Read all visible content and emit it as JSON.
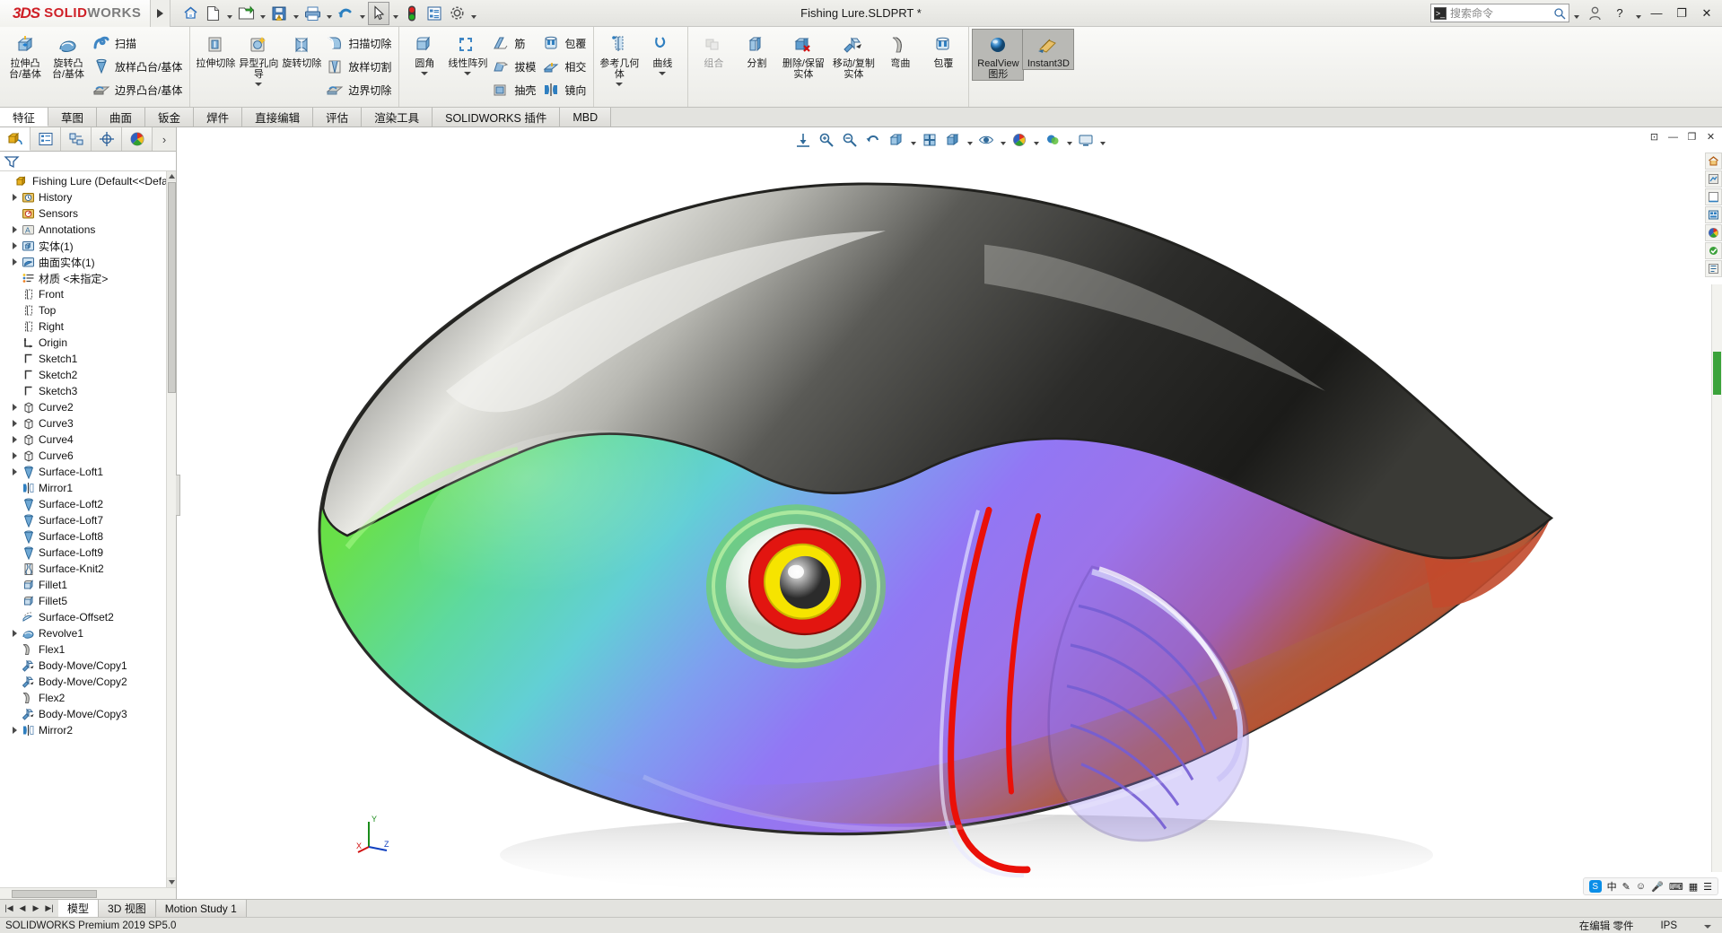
{
  "app": {
    "brand_ds": "3DS",
    "brand_solid": "SOLID",
    "brand_works": "WORKS",
    "document_title": "Fishing Lure.SLDPRT *"
  },
  "quick_access": [
    {
      "name": "home-icon",
      "label": "主页"
    },
    {
      "name": "new-document-icon",
      "label": "新建"
    },
    {
      "name": "open-document-icon",
      "label": "打开"
    },
    {
      "name": "save-icon",
      "label": "保存"
    },
    {
      "name": "print-icon",
      "label": "打印"
    },
    {
      "name": "undo-icon",
      "label": "撤消"
    },
    {
      "name": "select-cursor-icon",
      "label": "选择"
    },
    {
      "name": "rebuild-icon",
      "label": "重建模型"
    },
    {
      "name": "file-properties-icon",
      "label": "文件属性"
    },
    {
      "name": "options-gear-icon",
      "label": "选项"
    }
  ],
  "search": {
    "placeholder": "搜索命令",
    "icon": "magnifier-icon"
  },
  "window_controls": {
    "account": "user-account-icon",
    "help": "?",
    "minimize": "—",
    "restore": "❐",
    "close": "✕"
  },
  "ribbon": {
    "groups": [
      {
        "name": "boss-base-group",
        "big": [
          {
            "label": "拉伸凸台/基体",
            "icon": "extrude-boss-icon",
            "dropdown": false
          },
          {
            "label": "旋转凸台/基体",
            "icon": "revolve-boss-icon",
            "dropdown": false
          }
        ],
        "small": [
          {
            "label": "扫描",
            "icon": "sweep-icon"
          },
          {
            "label": "放样凸台/基体",
            "icon": "loft-boss-icon"
          },
          {
            "label": "边界凸台/基体",
            "icon": "boundary-boss-icon"
          }
        ]
      },
      {
        "name": "cut-group",
        "big": [
          {
            "label": "拉伸切除",
            "icon": "extrude-cut-icon",
            "dropdown": true
          },
          {
            "label": "异型孔向导",
            "icon": "hole-wizard-icon",
            "dropdown": true
          },
          {
            "label": "旋转切除",
            "icon": "revolve-cut-icon",
            "dropdown": false
          }
        ],
        "small": [
          {
            "label": "扫描切除",
            "icon": "sweep-cut-icon"
          },
          {
            "label": "放样切割",
            "icon": "loft-cut-icon"
          },
          {
            "label": "边界切除",
            "icon": "boundary-cut-icon"
          }
        ]
      },
      {
        "name": "feature-group",
        "big": [
          {
            "label": "圆角",
            "icon": "fillet-icon",
            "dropdown": true
          },
          {
            "label": "线性阵列",
            "icon": "linear-pattern-icon",
            "dropdown": true
          }
        ],
        "small": [
          {
            "label": "筋",
            "icon": "rib-icon"
          },
          {
            "label": "拔模",
            "icon": "draft-icon"
          },
          {
            "label": "抽壳",
            "icon": "shell-icon"
          }
        ],
        "small2": [
          {
            "label": "包覆",
            "icon": "wrap-icon"
          },
          {
            "label": "相交",
            "icon": "intersect-icon"
          },
          {
            "label": "镜向",
            "icon": "mirror-icon"
          }
        ]
      },
      {
        "name": "reference-group",
        "big": [
          {
            "label": "参考几何体",
            "icon": "reference-geometry-icon",
            "dropdown": true
          },
          {
            "label": "曲线",
            "icon": "curves-icon",
            "dropdown": true
          }
        ]
      },
      {
        "name": "bodies-group",
        "big": [
          {
            "label": "组合",
            "icon": "combine-icon",
            "disabled": true
          },
          {
            "label": "分割",
            "icon": "split-icon",
            "disabled": false
          },
          {
            "label": "删除/保留实体",
            "icon": "delete-keep-body-icon",
            "disabled": false
          },
          {
            "label": "移动/复制实体",
            "icon": "move-copy-body-icon",
            "disabled": false
          },
          {
            "label": "弯曲",
            "icon": "flex-icon",
            "disabled": false
          },
          {
            "label": "包覆",
            "icon": "wrap-icon",
            "disabled": false
          }
        ]
      },
      {
        "name": "display-group",
        "big": [
          {
            "label": "RealView 图形",
            "icon": "realview-sphere-icon",
            "active": true
          },
          {
            "label": "Instant3D",
            "icon": "instant3d-icon",
            "active": true
          }
        ]
      }
    ]
  },
  "command_tabs": {
    "items": [
      "特征",
      "草图",
      "曲面",
      "钣金",
      "焊件",
      "直接编辑",
      "评估",
      "渲染工具",
      "SOLIDWORKS 插件",
      "MBD"
    ],
    "selected_index": 0
  },
  "left_panel": {
    "tabs": [
      {
        "name": "feature-manager-tab",
        "icon": "feature-tree-icon",
        "selected": true
      },
      {
        "name": "property-manager-tab",
        "icon": "property-list-icon",
        "selected": false
      },
      {
        "name": "configuration-manager-tab",
        "icon": "configuration-icon",
        "selected": false
      },
      {
        "name": "dimxpert-manager-tab",
        "icon": "dimxpert-icon",
        "selected": false
      },
      {
        "name": "display-manager-tab",
        "icon": "display-palette-icon",
        "selected": false
      }
    ],
    "more_chevron": "›",
    "filter_icon": "filter-funnel-icon",
    "tree": [
      {
        "label": "Fishing Lure  (Default<<Default>_",
        "icon": "part-icon",
        "arrow": false,
        "root": true
      },
      {
        "label": "History",
        "icon": "history-icon",
        "arrow": true
      },
      {
        "label": "Sensors",
        "icon": "sensors-icon",
        "arrow": false
      },
      {
        "label": "Annotations",
        "icon": "annotations-icon",
        "arrow": true
      },
      {
        "label": "实体(1)",
        "icon": "solid-bodies-icon",
        "arrow": true
      },
      {
        "label": "曲面实体(1)",
        "icon": "surface-bodies-icon",
        "arrow": true
      },
      {
        "label": "材质 <未指定>",
        "icon": "material-icon",
        "arrow": false
      },
      {
        "label": "Front",
        "icon": "plane-icon",
        "arrow": false
      },
      {
        "label": "Top",
        "icon": "plane-icon",
        "arrow": false
      },
      {
        "label": "Right",
        "icon": "plane-icon",
        "arrow": false
      },
      {
        "label": "Origin",
        "icon": "origin-icon",
        "arrow": false
      },
      {
        "label": "Sketch1",
        "icon": "sketch-icon",
        "arrow": false
      },
      {
        "label": "Sketch2",
        "icon": "sketch-icon",
        "arrow": false
      },
      {
        "label": "Sketch3",
        "icon": "sketch-icon",
        "arrow": false
      },
      {
        "label": "Curve2",
        "icon": "curve-icon",
        "arrow": true
      },
      {
        "label": "Curve3",
        "icon": "curve-icon",
        "arrow": true
      },
      {
        "label": "Curve4",
        "icon": "curve-icon",
        "arrow": true
      },
      {
        "label": "Curve6",
        "icon": "curve-icon",
        "arrow": true
      },
      {
        "label": "Surface-Loft1",
        "icon": "surface-loft-icon",
        "arrow": true
      },
      {
        "label": "Mirror1",
        "icon": "mirror-feature-icon",
        "arrow": false
      },
      {
        "label": "Surface-Loft2",
        "icon": "surface-loft-icon",
        "arrow": false
      },
      {
        "label": "Surface-Loft7",
        "icon": "surface-loft-icon",
        "arrow": false
      },
      {
        "label": "Surface-Loft8",
        "icon": "surface-loft-icon",
        "arrow": false
      },
      {
        "label": "Surface-Loft9",
        "icon": "surface-loft-icon",
        "arrow": false
      },
      {
        "label": "Surface-Knit2",
        "icon": "surface-knit-icon",
        "arrow": false
      },
      {
        "label": "Fillet1",
        "icon": "fillet-feature-icon",
        "arrow": false
      },
      {
        "label": "Fillet5",
        "icon": "fillet-feature-icon",
        "arrow": false
      },
      {
        "label": "Surface-Offset2",
        "icon": "surface-offset-icon",
        "arrow": false
      },
      {
        "label": "Revolve1",
        "icon": "revolve-feature-icon",
        "arrow": true
      },
      {
        "label": "Flex1",
        "icon": "flex-feature-icon",
        "arrow": false
      },
      {
        "label": "Body-Move/Copy1",
        "icon": "move-copy-feature-icon",
        "arrow": false
      },
      {
        "label": "Body-Move/Copy2",
        "icon": "move-copy-feature-icon",
        "arrow": false
      },
      {
        "label": "Flex2",
        "icon": "flex-feature-icon",
        "arrow": false
      },
      {
        "label": "Body-Move/Copy3",
        "icon": "move-copy-feature-icon",
        "arrow": false
      },
      {
        "label": "Mirror2",
        "icon": "mirror-feature-icon",
        "arrow": true
      }
    ]
  },
  "view_toolbar": [
    {
      "name": "zoom-to-fit-icon"
    },
    {
      "name": "zoom-to-area-icon"
    },
    {
      "name": "zoom-in-out-icon"
    },
    {
      "name": "previous-view-icon"
    },
    {
      "name": "section-view-icon"
    },
    {
      "name": "view-orientation-icon"
    },
    {
      "name": "display-style-icon"
    },
    {
      "name": "hide-show-items-icon"
    },
    {
      "name": "edit-appearance-icon"
    },
    {
      "name": "apply-scene-icon"
    },
    {
      "name": "view-settings-icon"
    }
  ],
  "document_window_buttons": [
    "⊡",
    "—",
    "❐",
    "✕"
  ],
  "right_rail": [
    {
      "name": "view-home-icon"
    },
    {
      "name": "appearances-icon"
    },
    {
      "name": "scenes-icon"
    },
    {
      "name": "lights-cameras-icon"
    },
    {
      "name": "decals-icon"
    },
    {
      "name": "display-states-icon"
    },
    {
      "name": "custom-view-icon"
    }
  ],
  "triad": {
    "x_label": "X",
    "y_label": "Y",
    "z_label": "Z"
  },
  "ime_bar": {
    "logo": "S",
    "mode": "中",
    "items": [
      "✎",
      "☺",
      "🎤",
      "⌨",
      "▦",
      "☰"
    ]
  },
  "bottom_tabs": {
    "items": [
      "模型",
      "3D 视图",
      "Motion Study 1"
    ],
    "selected_index": 0,
    "nav_buttons": [
      "|◀",
      "◀",
      "▶",
      "▶|"
    ]
  },
  "status_bar": {
    "left": "SOLIDWORKS Premium 2019 SP5.0",
    "editing": "在编辑 零件",
    "units": "IPS",
    "caret": "▲"
  },
  "model_render": {
    "name": "fishing-lure-3d-model",
    "description": "彩色钓鱼诱饵三维曲面模型",
    "colors": {
      "back_dark": "#2d2d2d",
      "body_green": "#4bd22a",
      "body_cyan": "#5fd3c2",
      "body_purple": "#8a6ff0",
      "belly_red": "#b8482f",
      "eye_red": "#e01b15",
      "eye_yellow": "#f5e000",
      "eye_pupil": "#6d6d6d",
      "gill_stripe": "#e8140c"
    }
  }
}
